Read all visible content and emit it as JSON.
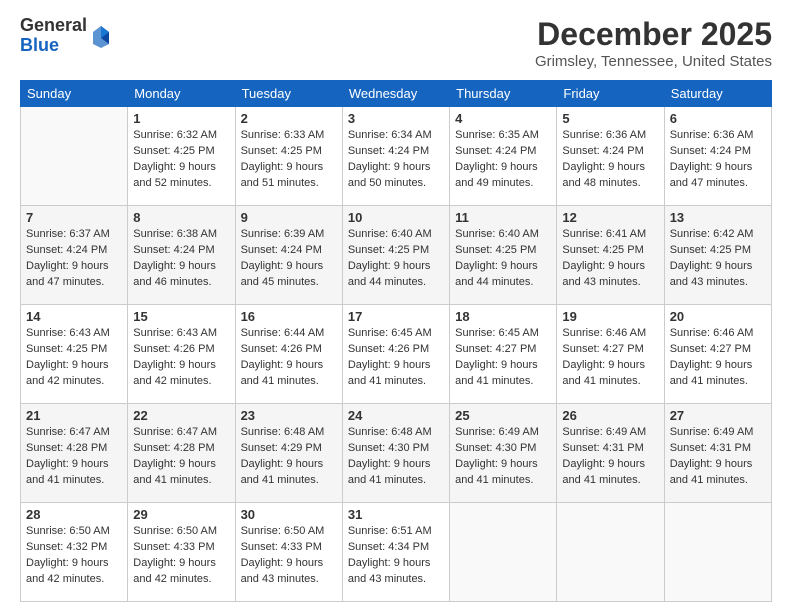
{
  "logo": {
    "general": "General",
    "blue": "Blue"
  },
  "title": "December 2025",
  "location": "Grimsley, Tennessee, United States",
  "days_of_week": [
    "Sunday",
    "Monday",
    "Tuesday",
    "Wednesday",
    "Thursday",
    "Friday",
    "Saturday"
  ],
  "weeks": [
    [
      {
        "num": "",
        "sunrise": "",
        "sunset": "",
        "daylight": ""
      },
      {
        "num": "1",
        "sunrise": "Sunrise: 6:32 AM",
        "sunset": "Sunset: 4:25 PM",
        "daylight": "Daylight: 9 hours and 52 minutes."
      },
      {
        "num": "2",
        "sunrise": "Sunrise: 6:33 AM",
        "sunset": "Sunset: 4:25 PM",
        "daylight": "Daylight: 9 hours and 51 minutes."
      },
      {
        "num": "3",
        "sunrise": "Sunrise: 6:34 AM",
        "sunset": "Sunset: 4:24 PM",
        "daylight": "Daylight: 9 hours and 50 minutes."
      },
      {
        "num": "4",
        "sunrise": "Sunrise: 6:35 AM",
        "sunset": "Sunset: 4:24 PM",
        "daylight": "Daylight: 9 hours and 49 minutes."
      },
      {
        "num": "5",
        "sunrise": "Sunrise: 6:36 AM",
        "sunset": "Sunset: 4:24 PM",
        "daylight": "Daylight: 9 hours and 48 minutes."
      },
      {
        "num": "6",
        "sunrise": "Sunrise: 6:36 AM",
        "sunset": "Sunset: 4:24 PM",
        "daylight": "Daylight: 9 hours and 47 minutes."
      }
    ],
    [
      {
        "num": "7",
        "sunrise": "Sunrise: 6:37 AM",
        "sunset": "Sunset: 4:24 PM",
        "daylight": "Daylight: 9 hours and 47 minutes."
      },
      {
        "num": "8",
        "sunrise": "Sunrise: 6:38 AM",
        "sunset": "Sunset: 4:24 PM",
        "daylight": "Daylight: 9 hours and 46 minutes."
      },
      {
        "num": "9",
        "sunrise": "Sunrise: 6:39 AM",
        "sunset": "Sunset: 4:24 PM",
        "daylight": "Daylight: 9 hours and 45 minutes."
      },
      {
        "num": "10",
        "sunrise": "Sunrise: 6:40 AM",
        "sunset": "Sunset: 4:25 PM",
        "daylight": "Daylight: 9 hours and 44 minutes."
      },
      {
        "num": "11",
        "sunrise": "Sunrise: 6:40 AM",
        "sunset": "Sunset: 4:25 PM",
        "daylight": "Daylight: 9 hours and 44 minutes."
      },
      {
        "num": "12",
        "sunrise": "Sunrise: 6:41 AM",
        "sunset": "Sunset: 4:25 PM",
        "daylight": "Daylight: 9 hours and 43 minutes."
      },
      {
        "num": "13",
        "sunrise": "Sunrise: 6:42 AM",
        "sunset": "Sunset: 4:25 PM",
        "daylight": "Daylight: 9 hours and 43 minutes."
      }
    ],
    [
      {
        "num": "14",
        "sunrise": "Sunrise: 6:43 AM",
        "sunset": "Sunset: 4:25 PM",
        "daylight": "Daylight: 9 hours and 42 minutes."
      },
      {
        "num": "15",
        "sunrise": "Sunrise: 6:43 AM",
        "sunset": "Sunset: 4:26 PM",
        "daylight": "Daylight: 9 hours and 42 minutes."
      },
      {
        "num": "16",
        "sunrise": "Sunrise: 6:44 AM",
        "sunset": "Sunset: 4:26 PM",
        "daylight": "Daylight: 9 hours and 41 minutes."
      },
      {
        "num": "17",
        "sunrise": "Sunrise: 6:45 AM",
        "sunset": "Sunset: 4:26 PM",
        "daylight": "Daylight: 9 hours and 41 minutes."
      },
      {
        "num": "18",
        "sunrise": "Sunrise: 6:45 AM",
        "sunset": "Sunset: 4:27 PM",
        "daylight": "Daylight: 9 hours and 41 minutes."
      },
      {
        "num": "19",
        "sunrise": "Sunrise: 6:46 AM",
        "sunset": "Sunset: 4:27 PM",
        "daylight": "Daylight: 9 hours and 41 minutes."
      },
      {
        "num": "20",
        "sunrise": "Sunrise: 6:46 AM",
        "sunset": "Sunset: 4:27 PM",
        "daylight": "Daylight: 9 hours and 41 minutes."
      }
    ],
    [
      {
        "num": "21",
        "sunrise": "Sunrise: 6:47 AM",
        "sunset": "Sunset: 4:28 PM",
        "daylight": "Daylight: 9 hours and 41 minutes."
      },
      {
        "num": "22",
        "sunrise": "Sunrise: 6:47 AM",
        "sunset": "Sunset: 4:28 PM",
        "daylight": "Daylight: 9 hours and 41 minutes."
      },
      {
        "num": "23",
        "sunrise": "Sunrise: 6:48 AM",
        "sunset": "Sunset: 4:29 PM",
        "daylight": "Daylight: 9 hours and 41 minutes."
      },
      {
        "num": "24",
        "sunrise": "Sunrise: 6:48 AM",
        "sunset": "Sunset: 4:30 PM",
        "daylight": "Daylight: 9 hours and 41 minutes."
      },
      {
        "num": "25",
        "sunrise": "Sunrise: 6:49 AM",
        "sunset": "Sunset: 4:30 PM",
        "daylight": "Daylight: 9 hours and 41 minutes."
      },
      {
        "num": "26",
        "sunrise": "Sunrise: 6:49 AM",
        "sunset": "Sunset: 4:31 PM",
        "daylight": "Daylight: 9 hours and 41 minutes."
      },
      {
        "num": "27",
        "sunrise": "Sunrise: 6:49 AM",
        "sunset": "Sunset: 4:31 PM",
        "daylight": "Daylight: 9 hours and 41 minutes."
      }
    ],
    [
      {
        "num": "28",
        "sunrise": "Sunrise: 6:50 AM",
        "sunset": "Sunset: 4:32 PM",
        "daylight": "Daylight: 9 hours and 42 minutes."
      },
      {
        "num": "29",
        "sunrise": "Sunrise: 6:50 AM",
        "sunset": "Sunset: 4:33 PM",
        "daylight": "Daylight: 9 hours and 42 minutes."
      },
      {
        "num": "30",
        "sunrise": "Sunrise: 6:50 AM",
        "sunset": "Sunset: 4:33 PM",
        "daylight": "Daylight: 9 hours and 43 minutes."
      },
      {
        "num": "31",
        "sunrise": "Sunrise: 6:51 AM",
        "sunset": "Sunset: 4:34 PM",
        "daylight": "Daylight: 9 hours and 43 minutes."
      },
      {
        "num": "",
        "sunrise": "",
        "sunset": "",
        "daylight": ""
      },
      {
        "num": "",
        "sunrise": "",
        "sunset": "",
        "daylight": ""
      },
      {
        "num": "",
        "sunrise": "",
        "sunset": "",
        "daylight": ""
      }
    ]
  ]
}
